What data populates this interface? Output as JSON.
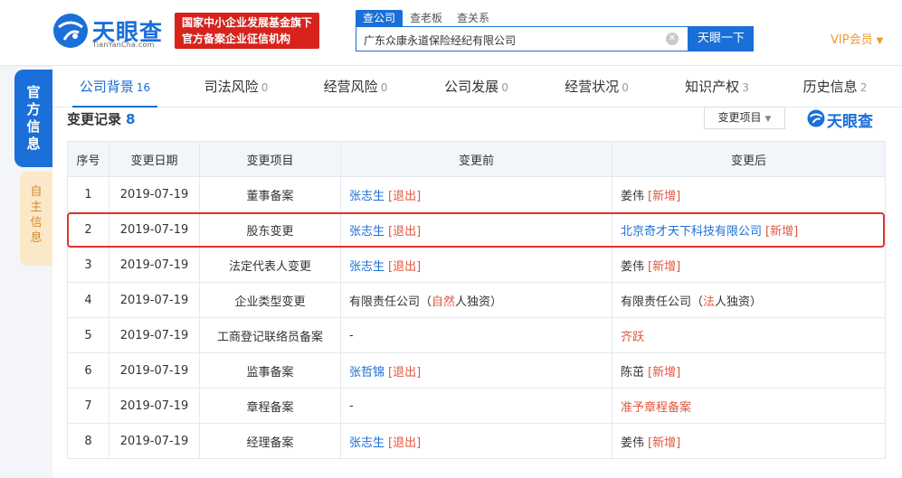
{
  "header": {
    "logo_text": "天眼查",
    "logo_sub": "TianYanCha.com",
    "gov_badge_line1": "国家中小企业发展基金旗下",
    "gov_badge_line2": "官方备案企业征信机构",
    "search_tabs": [
      "查公司",
      "查老板",
      "查关系"
    ],
    "search_value": "广东众康永道保险经纪有限公司",
    "search_button": "天眼一下",
    "vip_label": "VIP会员"
  },
  "side": {
    "official": [
      "官",
      "方",
      "信",
      "息"
    ],
    "self": [
      "自",
      "主",
      "信",
      "息"
    ]
  },
  "nav": [
    {
      "label": "公司背景",
      "count": "16"
    },
    {
      "label": "司法风险",
      "count": "0"
    },
    {
      "label": "经营风险",
      "count": "0"
    },
    {
      "label": "公司发展",
      "count": "0"
    },
    {
      "label": "经营状况",
      "count": "0"
    },
    {
      "label": "知识产权",
      "count": "3"
    },
    {
      "label": "历史信息",
      "count": "2"
    }
  ],
  "section": {
    "title": "变更记录",
    "count": "8",
    "filter_label": "变更项目",
    "watermark": "天眼查"
  },
  "table": {
    "headers": [
      "序号",
      "变更日期",
      "变更项目",
      "变更前",
      "变更后"
    ],
    "rows": [
      {
        "no": "1",
        "date": "2019-07-19",
        "item": "董事备案",
        "before": [
          {
            "text": "张志生",
            "style": "link"
          },
          {
            "text": "[退出]",
            "style": "tag"
          }
        ],
        "after": [
          {
            "text": "姜伟",
            "style": "plain"
          },
          {
            "text": "[新增]",
            "style": "tag"
          }
        ]
      },
      {
        "no": "2",
        "date": "2019-07-19",
        "item": "股东变更",
        "before": [
          {
            "text": "张志生",
            "style": "link"
          },
          {
            "text": "[退出]",
            "style": "tag"
          }
        ],
        "after": [
          {
            "text": "北京奇才天下科技有限公司",
            "style": "link"
          },
          {
            "text": "[新增]",
            "style": "tag"
          }
        ]
      },
      {
        "no": "3",
        "date": "2019-07-19",
        "item": "法定代表人变更",
        "before": [
          {
            "text": "张志生",
            "style": "link"
          },
          {
            "text": "[退出]",
            "style": "tag"
          }
        ],
        "after": [
          {
            "text": "姜伟",
            "style": "plain"
          },
          {
            "text": "[新增]",
            "style": "tag"
          }
        ]
      },
      {
        "no": "4",
        "date": "2019-07-19",
        "item": "企业类型变更",
        "before": [
          {
            "text": "有限责任公司（",
            "style": "plain"
          },
          {
            "text": "自然",
            "style": "red"
          },
          {
            "text": "人独资）",
            "style": "plain"
          }
        ],
        "after": [
          {
            "text": "有限责任公司（",
            "style": "plain"
          },
          {
            "text": "法",
            "style": "red"
          },
          {
            "text": "人独资）",
            "style": "plain"
          }
        ]
      },
      {
        "no": "5",
        "date": "2019-07-19",
        "item": "工商登记联络员备案",
        "before": [
          {
            "text": "-",
            "style": "plain"
          }
        ],
        "after": [
          {
            "text": "齐跃",
            "style": "red"
          }
        ]
      },
      {
        "no": "6",
        "date": "2019-07-19",
        "item": "监事备案",
        "before": [
          {
            "text": "张哲锦",
            "style": "link"
          },
          {
            "text": "[退出]",
            "style": "tag"
          }
        ],
        "after": [
          {
            "text": "陈茁",
            "style": "plain"
          },
          {
            "text": "[新增]",
            "style": "tag"
          }
        ]
      },
      {
        "no": "7",
        "date": "2019-07-19",
        "item": "章程备案",
        "before": [
          {
            "text": "-",
            "style": "plain"
          }
        ],
        "after": [
          {
            "text": "准予章程备案",
            "style": "red"
          }
        ]
      },
      {
        "no": "8",
        "date": "2019-07-19",
        "item": "经理备案",
        "before": [
          {
            "text": "张志生",
            "style": "link"
          },
          {
            "text": "[退出]",
            "style": "tag"
          }
        ],
        "after": [
          {
            "text": "姜伟",
            "style": "plain"
          },
          {
            "text": "[新增]",
            "style": "tag"
          }
        ]
      }
    ],
    "highlighted_row": "2"
  },
  "colors": {
    "brand": "#1a6fd8",
    "badge": "#d7231c",
    "vip": "#f39a2b",
    "tag": "#e2563f",
    "highlight": "#e3322b"
  },
  "icons": [
    "tianyancha-logo-icon",
    "clear-search-icon",
    "dropdown-caret-icon"
  ]
}
